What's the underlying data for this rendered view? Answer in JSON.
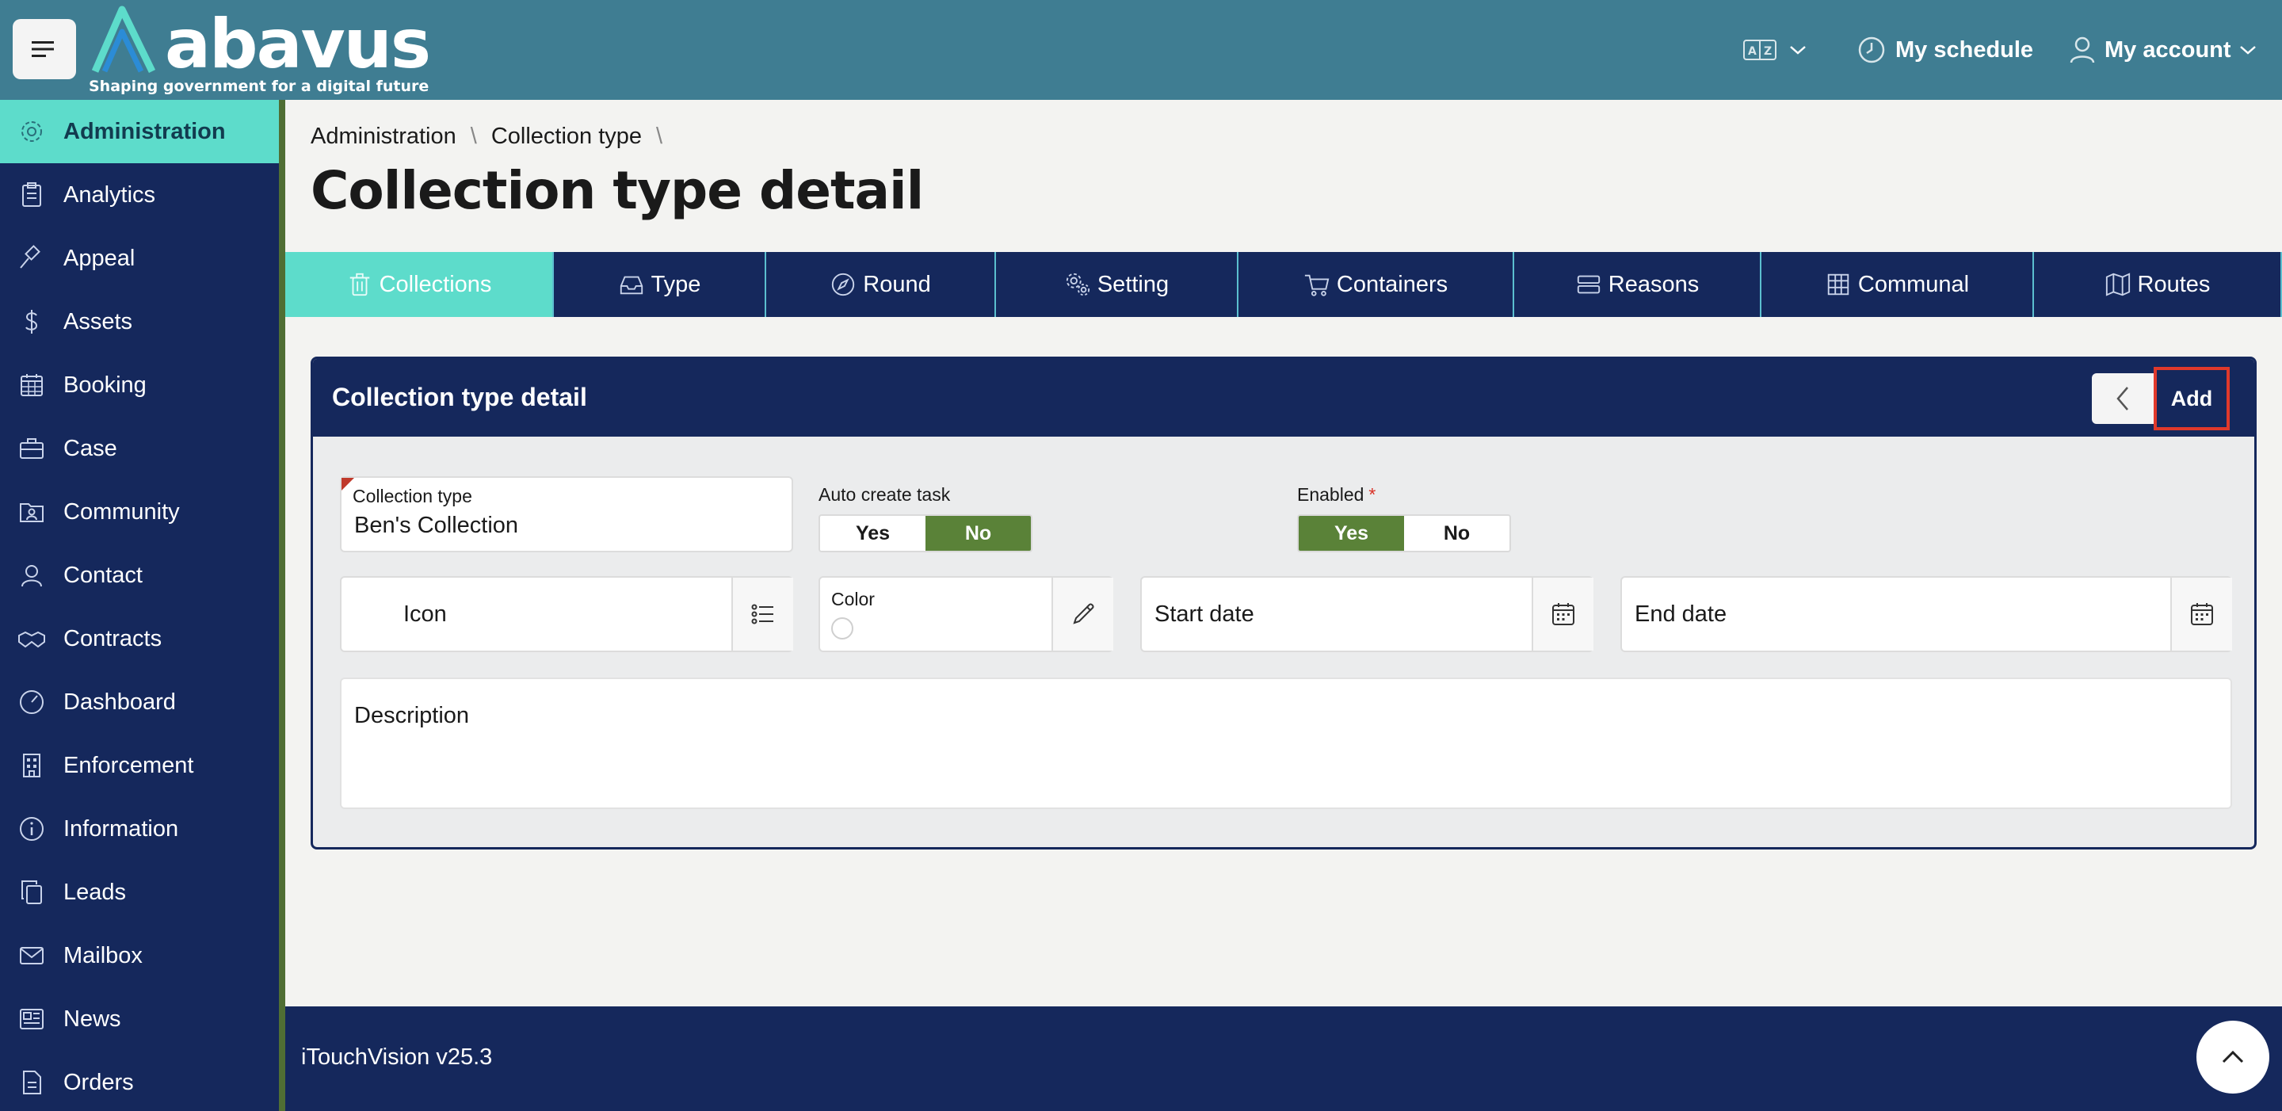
{
  "header": {
    "logo_text": "abavus",
    "logo_tagline": "Shaping government for a digital future",
    "language_icon": "language-icon",
    "schedule_label": "My schedule",
    "account_label": "My account"
  },
  "sidebar": {
    "items": [
      {
        "label": "Administration",
        "icon": "gear-icon",
        "active": true
      },
      {
        "label": "Analytics",
        "icon": "clipboard-icon"
      },
      {
        "label": "Appeal",
        "icon": "gavel-icon"
      },
      {
        "label": "Assets",
        "icon": "dollar-icon"
      },
      {
        "label": "Booking",
        "icon": "calendar-icon"
      },
      {
        "label": "Case",
        "icon": "briefcase-icon"
      },
      {
        "label": "Community",
        "icon": "person-folder-icon"
      },
      {
        "label": "Contact",
        "icon": "user-icon"
      },
      {
        "label": "Contracts",
        "icon": "handshake-icon"
      },
      {
        "label": "Dashboard",
        "icon": "gauge-icon"
      },
      {
        "label": "Enforcement",
        "icon": "building-icon"
      },
      {
        "label": "Information",
        "icon": "info-icon"
      },
      {
        "label": "Leads",
        "icon": "copy-icon"
      },
      {
        "label": "Mailbox",
        "icon": "envelope-icon"
      },
      {
        "label": "News",
        "icon": "newspaper-icon"
      },
      {
        "label": "Orders",
        "icon": "document-icon"
      }
    ]
  },
  "breadcrumb": {
    "items": [
      "Administration",
      "Collection type"
    ]
  },
  "page_title": "Collection type detail",
  "tabs": [
    {
      "label": "Collections",
      "icon": "trash-icon",
      "active": true
    },
    {
      "label": "Type",
      "icon": "inbox-icon"
    },
    {
      "label": "Round",
      "icon": "compass-icon"
    },
    {
      "label": "Setting",
      "icon": "gears-icon"
    },
    {
      "label": "Containers",
      "icon": "cart-icon"
    },
    {
      "label": "Reasons",
      "icon": "list-bars-icon"
    },
    {
      "label": "Communal",
      "icon": "grid-icon"
    },
    {
      "label": "Routes",
      "icon": "map-icon"
    }
  ],
  "panel": {
    "title": "Collection type detail",
    "add_label": "Add"
  },
  "form": {
    "collection_type": {
      "label": "Collection type",
      "value": "Ben's Collection"
    },
    "auto_create_task": {
      "label": "Auto create task",
      "yes": "Yes",
      "no": "No",
      "selected": "No"
    },
    "enabled": {
      "label": "Enabled",
      "required_mark": "*",
      "yes": "Yes",
      "no": "No",
      "selected": "Yes"
    },
    "icon_field": {
      "placeholder": "Icon"
    },
    "color_field": {
      "label": "Color"
    },
    "start_date": {
      "placeholder": "Start date"
    },
    "end_date": {
      "placeholder": "End date"
    },
    "description": {
      "placeholder": "Description"
    }
  },
  "footer": {
    "version": "iTouchVision v25.3"
  },
  "colors": {
    "header": "#3f7d92",
    "sidebar": "#15285c",
    "accent": "#5ddccb",
    "toggle_on": "#5a8238",
    "highlight": "#e0392b"
  }
}
